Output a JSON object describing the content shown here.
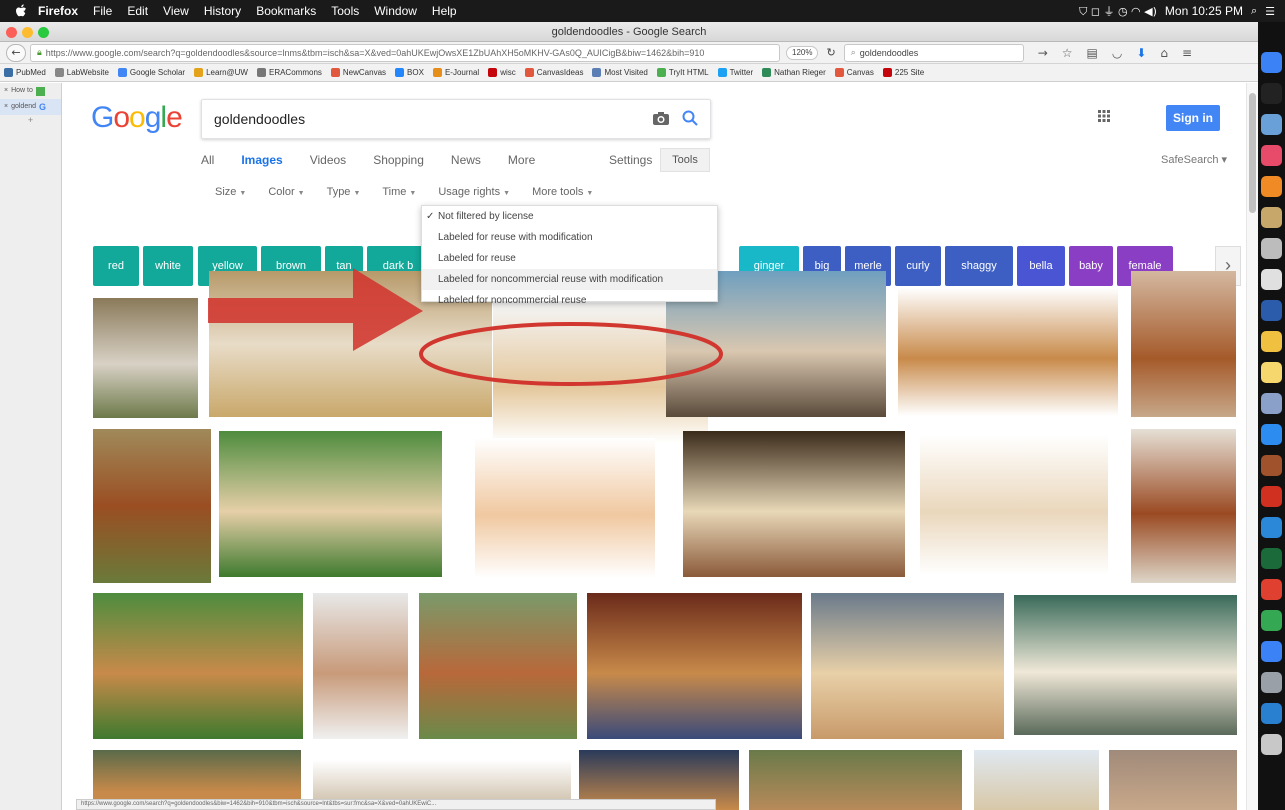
{
  "menubar": {
    "app_name": "Firefox",
    "items": [
      "File",
      "Edit",
      "View",
      "History",
      "Bookmarks",
      "Tools",
      "Window",
      "Help"
    ],
    "clock": "Mon 10:25 PM"
  },
  "window": {
    "title": "goldendoodles - Google Search"
  },
  "navbar": {
    "url": "https://www.google.com/search?q=goldendoodles&source=lnms&tbm=isch&sa=X&ved=0ahUKEwjOwsXE1ZbUAhXH5oMKHV-GAs0Q_AUICigB&biw=1462&bih=910",
    "zoom": "120%",
    "search_text": "goldendoodles"
  },
  "bookmarks": [
    {
      "label": "PubMed",
      "color": "#3a6ea5"
    },
    {
      "label": "LabWebsite",
      "color": "#888888"
    },
    {
      "label": "Google Scholar",
      "color": "#4285f4"
    },
    {
      "label": "Learn@UW",
      "color": "#e3a21a"
    },
    {
      "label": "ERACommons",
      "color": "#777777"
    },
    {
      "label": "NewCanvas",
      "color": "#e2583e"
    },
    {
      "label": "BOX",
      "color": "#2486fc"
    },
    {
      "label": "E-Journal",
      "color": "#e58e1a"
    },
    {
      "label": "wisc",
      "color": "#c5050c"
    },
    {
      "label": "CanvasIdeas",
      "color": "#e2583e"
    },
    {
      "label": "Most Visited",
      "color": "#5b7fb5"
    },
    {
      "label": "TryIt HTML",
      "color": "#4caf50"
    },
    {
      "label": "Twitter",
      "color": "#1da1f2"
    },
    {
      "label": "Nathan Rieger",
      "color": "#2e8b57"
    },
    {
      "label": "Canvas",
      "color": "#e2583e"
    },
    {
      "label": "225 Site",
      "color": "#c5050c"
    }
  ],
  "sidebar": {
    "tabs": [
      {
        "label": "How to"
      },
      {
        "label": "goldend"
      }
    ]
  },
  "google": {
    "logo": "Google",
    "query": "goldendoodles",
    "signin": "Sign in",
    "tabs": [
      "All",
      "Images",
      "Videos",
      "Shopping",
      "News",
      "More"
    ],
    "settings": "Settings",
    "tools": "Tools",
    "safesearch": "SafeSearch ▾",
    "tool_filters": [
      "Size",
      "Color",
      "Type",
      "Time",
      "Usage rights",
      "More tools"
    ],
    "chips": [
      {
        "label": "red",
        "color": "#12a89a"
      },
      {
        "label": "white",
        "color": "#12a89a"
      },
      {
        "label": "yellow",
        "color": "#12a89a"
      },
      {
        "label": "brown",
        "color": "#12a89a"
      },
      {
        "label": "tan",
        "color": "#12a89a"
      },
      {
        "label": "dark b",
        "color": "#12a89a"
      },
      {
        "label": "ginger",
        "color": "#19b8c8"
      },
      {
        "label": "big",
        "color": "#3d5fc4"
      },
      {
        "label": "merle",
        "color": "#3d5fc4"
      },
      {
        "label": "curly",
        "color": "#3d5fc4"
      },
      {
        "label": "shaggy",
        "color": "#3d5fc4"
      },
      {
        "label": "bella",
        "color": "#4a55d4"
      },
      {
        "label": "baby",
        "color": "#8a3ec4"
      },
      {
        "label": "female",
        "color": "#8a3ec4"
      }
    ],
    "usage_menu": [
      "Not filtered by license",
      "Labeled for reuse with modification",
      "Labeled for reuse",
      "Labeled for noncommercial reuse with modification",
      "Labeled for noncommercial reuse"
    ],
    "status_url": "https://www.google.com/search?q=goldendoodles&biw=1462&bih=910&tbm=isch&source=lnt&tbs=sur:fmc&sa=X&ved=0ahUKEwiC..."
  },
  "colors": {
    "accent": "#4285f4",
    "annotation_red": "#d1362f"
  }
}
